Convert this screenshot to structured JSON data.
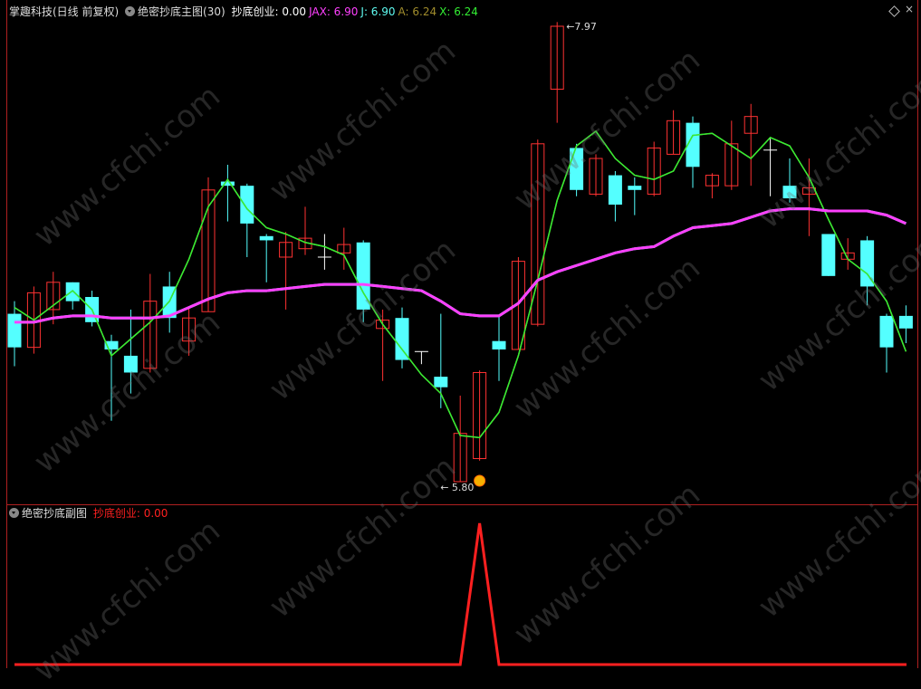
{
  "header": {
    "main": {
      "title": "掌趣科技(日线 前复权)",
      "indicator": "绝密抄底主图(30)",
      "items": [
        {
          "label": "抄底创业:",
          "value": "0.00",
          "color": "#ffffff"
        },
        {
          "label": "JAX:",
          "value": "6.90",
          "color": "#ff40ff"
        },
        {
          "label": "J:",
          "value": "6.90",
          "color": "#5ffbf1"
        },
        {
          "label": "A:",
          "value": "6.24",
          "color": "#a08c2c"
        },
        {
          "label": "X:",
          "value": "6.24",
          "color": "#33ee33"
        }
      ]
    },
    "sub": {
      "indicator": "绝密抄底副图",
      "items": [
        {
          "label": "抄底创业:",
          "value": "0.00",
          "color": "#ff2020"
        }
      ]
    }
  },
  "watermark": "www.cfchi.com",
  "chart_data": [
    {
      "type": "candlestick",
      "colors": {
        "up": "#ff3232",
        "down": "#54ffff",
        "doji": "#ffffff"
      },
      "candles": [
        {
          "o": 6.6,
          "h": 6.66,
          "l": 6.35,
          "c": 6.44
        },
        {
          "o": 6.44,
          "h": 6.73,
          "l": 6.41,
          "c": 6.7
        },
        {
          "o": 6.62,
          "h": 6.8,
          "l": 6.55,
          "c": 6.75
        },
        {
          "o": 6.75,
          "h": 6.75,
          "l": 6.62,
          "c": 6.66
        },
        {
          "o": 6.68,
          "h": 6.71,
          "l": 6.54,
          "c": 6.56
        },
        {
          "o": 6.47,
          "h": 6.5,
          "l": 6.09,
          "c": 6.43
        },
        {
          "o": 6.4,
          "h": 6.62,
          "l": 6.22,
          "c": 6.32
        },
        {
          "o": 6.34,
          "h": 6.79,
          "l": 6.32,
          "c": 6.66
        },
        {
          "o": 6.73,
          "h": 6.8,
          "l": 6.51,
          "c": 6.58
        },
        {
          "o": 6.47,
          "h": 6.63,
          "l": 6.4,
          "c": 6.58
        },
        {
          "o": 6.61,
          "h": 7.25,
          "l": 6.61,
          "c": 7.19
        },
        {
          "o": 7.23,
          "h": 7.31,
          "l": 7.04,
          "c": 7.21
        },
        {
          "o": 7.21,
          "h": 7.22,
          "l": 6.87,
          "c": 7.03
        },
        {
          "o": 6.97,
          "h": 6.98,
          "l": 6.75,
          "c": 6.95
        },
        {
          "o": 6.87,
          "h": 6.99,
          "l": 6.62,
          "c": 6.94
        },
        {
          "o": 6.91,
          "h": 7.11,
          "l": 6.88,
          "c": 6.96
        },
        {
          "o": 6.87,
          "h": 6.98,
          "l": 6.81,
          "c": 6.87,
          "d": true
        },
        {
          "o": 6.89,
          "h": 7.01,
          "l": 6.81,
          "c": 6.93
        },
        {
          "o": 6.94,
          "h": 6.95,
          "l": 6.56,
          "c": 6.62
        },
        {
          "o": 6.53,
          "h": 6.62,
          "l": 6.28,
          "c": 6.57
        },
        {
          "o": 6.58,
          "h": 6.63,
          "l": 6.34,
          "c": 6.38
        },
        {
          "o": 6.42,
          "h": 6.42,
          "l": 6.36,
          "c": 6.42,
          "d": true
        },
        {
          "o": 6.3,
          "h": 6.6,
          "l": 6.15,
          "c": 6.25
        },
        {
          "o": 5.8,
          "h": 6.21,
          "l": 5.8,
          "c": 6.03
        },
        {
          "o": 5.91,
          "h": 6.33,
          "l": 5.9,
          "c": 6.32
        },
        {
          "o": 6.47,
          "h": 6.59,
          "l": 6.28,
          "c": 6.43
        },
        {
          "o": 6.43,
          "h": 6.87,
          "l": 6.43,
          "c": 6.85
        },
        {
          "o": 6.55,
          "h": 7.43,
          "l": 6.54,
          "c": 7.41
        },
        {
          "o": 7.67,
          "h": 7.99,
          "l": 7.51,
          "c": 7.97
        },
        {
          "o": 7.39,
          "h": 7.41,
          "l": 7.16,
          "c": 7.19
        },
        {
          "o": 7.17,
          "h": 7.36,
          "l": 7.16,
          "c": 7.34
        },
        {
          "o": 7.26,
          "h": 7.28,
          "l": 7.04,
          "c": 7.12
        },
        {
          "o": 7.21,
          "h": 7.25,
          "l": 7.07,
          "c": 7.19
        },
        {
          "o": 7.17,
          "h": 7.42,
          "l": 7.16,
          "c": 7.39
        },
        {
          "o": 7.36,
          "h": 7.57,
          "l": 7.36,
          "c": 7.52
        },
        {
          "o": 7.51,
          "h": 7.54,
          "l": 7.2,
          "c": 7.3
        },
        {
          "o": 7.21,
          "h": 7.27,
          "l": 7.15,
          "c": 7.26
        },
        {
          "o": 7.21,
          "h": 7.52,
          "l": 7.19,
          "c": 7.41
        },
        {
          "o": 7.46,
          "h": 7.6,
          "l": 7.21,
          "c": 7.54
        },
        {
          "o": 7.38,
          "h": 7.44,
          "l": 7.16,
          "c": 7.38,
          "d": true
        },
        {
          "o": 7.21,
          "h": 7.34,
          "l": 7.13,
          "c": 7.15
        },
        {
          "o": 7.17,
          "h": 7.34,
          "l": 6.97,
          "c": 7.2
        },
        {
          "o": 6.98,
          "h": 6.98,
          "l": 6.78,
          "c": 6.78
        },
        {
          "o": 6.86,
          "h": 6.96,
          "l": 6.81,
          "c": 6.89
        },
        {
          "o": 6.95,
          "h": 6.97,
          "l": 6.64,
          "c": 6.73
        },
        {
          "o": 6.59,
          "h": 6.6,
          "l": 6.32,
          "c": 6.44
        },
        {
          "o": 6.59,
          "h": 6.64,
          "l": 6.46,
          "c": 6.53
        }
      ],
      "lines": [
        {
          "name": "A",
          "color": "#a08c2c",
          "values": [
            6.63,
            6.57,
            6.64,
            6.71,
            6.62,
            6.4,
            6.48,
            6.56,
            6.66,
            6.86,
            7.11,
            7.24,
            7.1,
            7.01,
            6.98,
            6.94,
            6.92,
            6.88,
            6.7,
            6.55,
            6.43,
            6.31,
            6.22,
            6.02,
            6.01,
            6.13,
            6.4,
            6.76,
            7.14,
            7.4,
            7.47,
            7.34,
            7.26,
            7.24,
            7.28,
            7.45,
            7.46,
            7.4,
            7.34,
            7.44,
            7.4,
            7.25,
            7.05,
            6.86,
            6.79,
            6.66,
            6.42
          ]
        },
        {
          "name": "X",
          "color": "#33ee33",
          "values": [
            6.63,
            6.57,
            6.64,
            6.71,
            6.62,
            6.4,
            6.48,
            6.56,
            6.66,
            6.86,
            7.11,
            7.24,
            7.1,
            7.01,
            6.98,
            6.94,
            6.92,
            6.88,
            6.7,
            6.55,
            6.43,
            6.31,
            6.22,
            6.02,
            6.01,
            6.13,
            6.4,
            6.76,
            7.14,
            7.4,
            7.47,
            7.34,
            7.26,
            7.24,
            7.28,
            7.45,
            7.46,
            7.4,
            7.34,
            7.44,
            7.4,
            7.25,
            7.05,
            6.86,
            6.79,
            6.66,
            6.42
          ]
        },
        {
          "name": "J",
          "color": "#5ffbf1",
          "values": [
            6.56,
            6.56,
            6.58,
            6.59,
            6.59,
            6.58,
            6.58,
            6.58,
            6.59,
            6.63,
            6.67,
            6.7,
            6.71,
            6.71,
            6.72,
            6.73,
            6.74,
            6.74,
            6.74,
            6.73,
            6.72,
            6.71,
            6.66,
            6.6,
            6.59,
            6.59,
            6.65,
            6.76,
            6.8,
            6.83,
            6.86,
            6.89,
            6.91,
            6.92,
            6.97,
            7.01,
            7.02,
            7.03,
            7.06,
            7.09,
            7.1,
            7.1,
            7.09,
            7.09,
            7.09,
            7.07,
            7.03
          ]
        },
        {
          "name": "JAX",
          "color": "#ff40ff",
          "values": [
            6.56,
            6.56,
            6.58,
            6.59,
            6.59,
            6.58,
            6.58,
            6.58,
            6.59,
            6.63,
            6.67,
            6.7,
            6.71,
            6.71,
            6.72,
            6.73,
            6.74,
            6.74,
            6.74,
            6.73,
            6.72,
            6.71,
            6.66,
            6.6,
            6.59,
            6.59,
            6.65,
            6.76,
            6.8,
            6.83,
            6.86,
            6.89,
            6.91,
            6.92,
            6.97,
            7.01,
            7.02,
            7.03,
            7.06,
            7.09,
            7.1,
            7.1,
            7.09,
            7.09,
            7.09,
            7.07,
            7.03
          ]
        }
      ],
      "annotations": [
        {
          "text": "7.97",
          "candle": 28,
          "value": 7.97
        },
        {
          "text": "5.80",
          "candle": 23,
          "value": 5.8
        }
      ]
    },
    {
      "type": "line",
      "name": "抄底创业",
      "color": "#ff2020",
      "values": [
        0,
        0,
        0,
        0,
        0,
        0,
        0,
        0,
        0,
        0,
        0,
        0,
        0,
        0,
        0,
        0,
        0,
        0,
        0,
        0,
        0,
        0,
        0,
        0,
        1,
        0,
        0,
        0,
        0,
        0,
        0,
        0,
        0,
        0,
        0,
        0,
        0,
        0,
        0,
        0,
        0,
        0,
        0,
        0,
        0,
        0,
        0
      ],
      "ylim": [
        0,
        1
      ]
    }
  ]
}
